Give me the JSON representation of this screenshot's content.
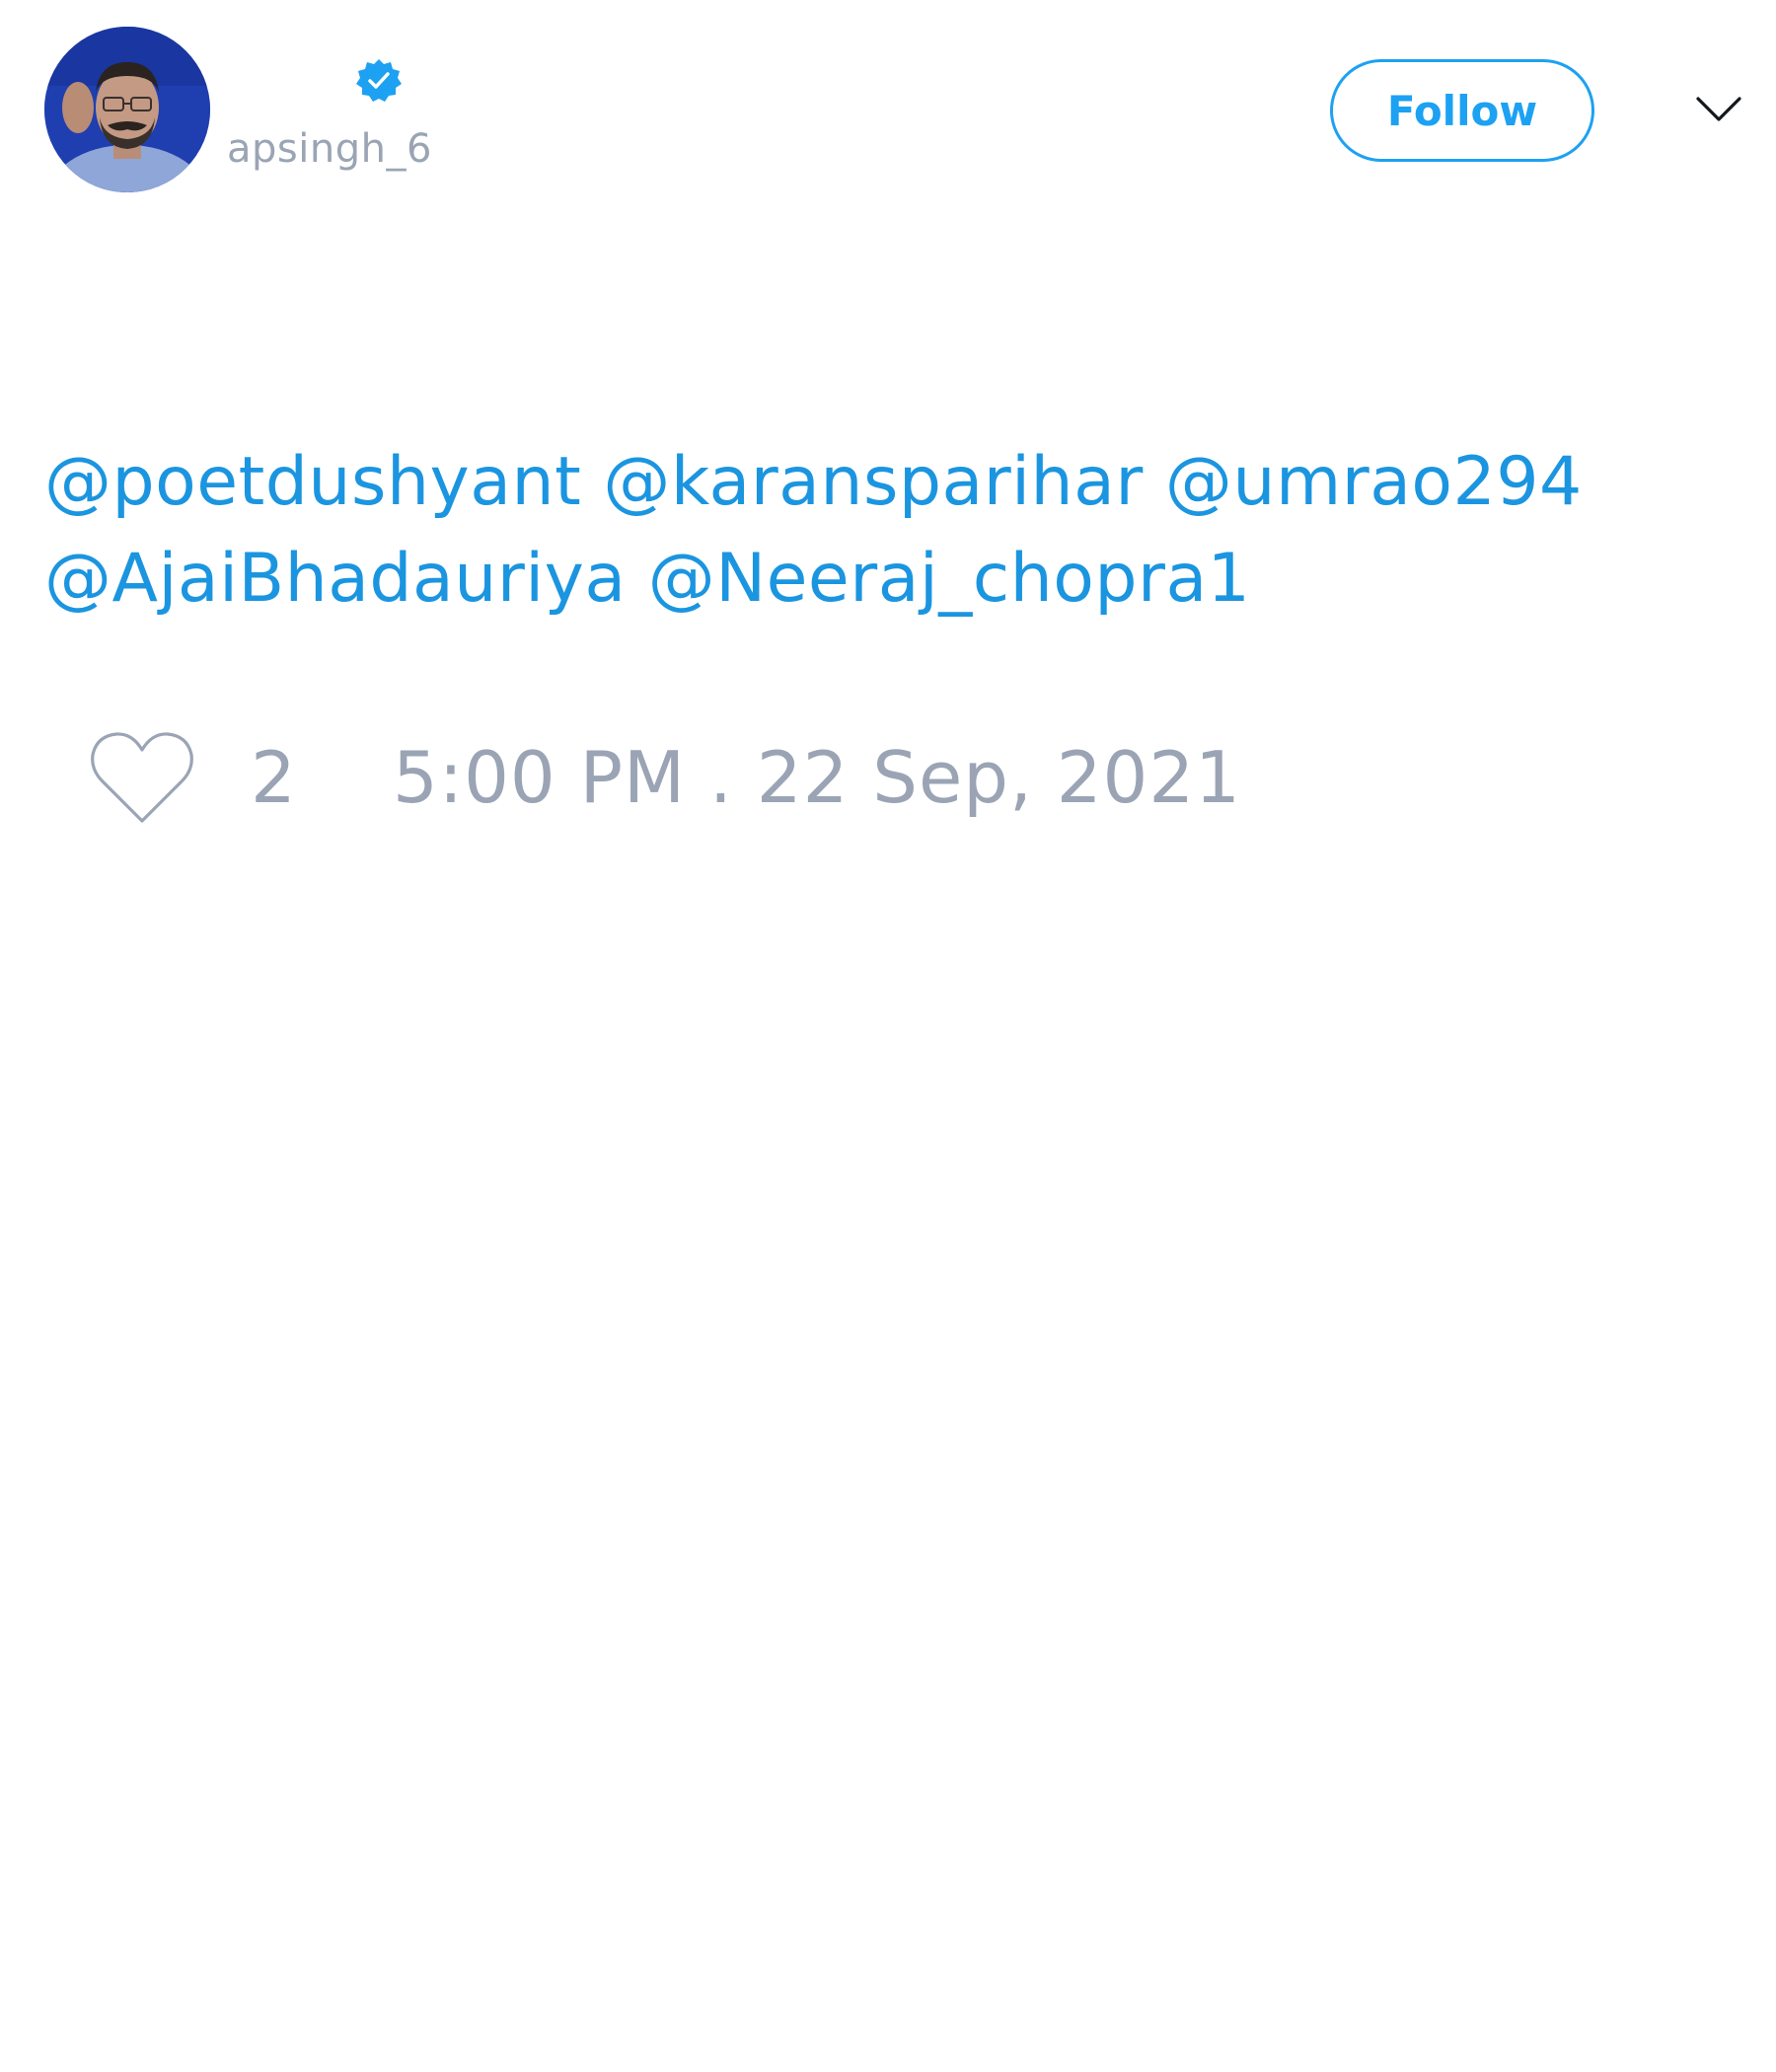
{
  "author": {
    "display_name": "",
    "handle": "apsingh_6",
    "verified": true
  },
  "header": {
    "follow_label": "Follow"
  },
  "tweet": {
    "mentions": [
      "@poetdushyant",
      "@karansparihar",
      "@umrao294",
      "@AjaiBhadauriya",
      "@Neeraj_chopra1"
    ]
  },
  "footer": {
    "like_count": "2",
    "timestamp": "5:00 PM . 22 Sep, 2021"
  },
  "icons": {
    "verified": "verified-badge-icon",
    "menu": "chevron-down-icon",
    "like": "heart-outline-icon"
  },
  "colors": {
    "accent": "#1da1f2",
    "mention": "#1b95e0",
    "muted": "#9aa4b4"
  }
}
